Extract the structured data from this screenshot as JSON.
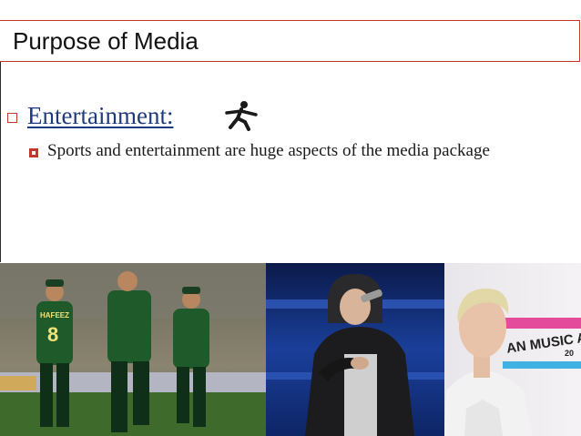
{
  "slide": {
    "title": "Purpose of Media",
    "heading": "Entertainment:",
    "body": "Sports and entertainment are huge aspects of the media package"
  },
  "photos": {
    "award_sign": "AN MUSIC AWA",
    "award_sign_small": "20",
    "jersey_name": "HAFEEZ",
    "jersey_number": "8"
  },
  "colors": {
    "accent": "#c0392b",
    "heading": "#1f3a7a"
  },
  "icons": [
    "square-bullet-icon",
    "runner-icon",
    "filled-square-bullet-icon"
  ]
}
